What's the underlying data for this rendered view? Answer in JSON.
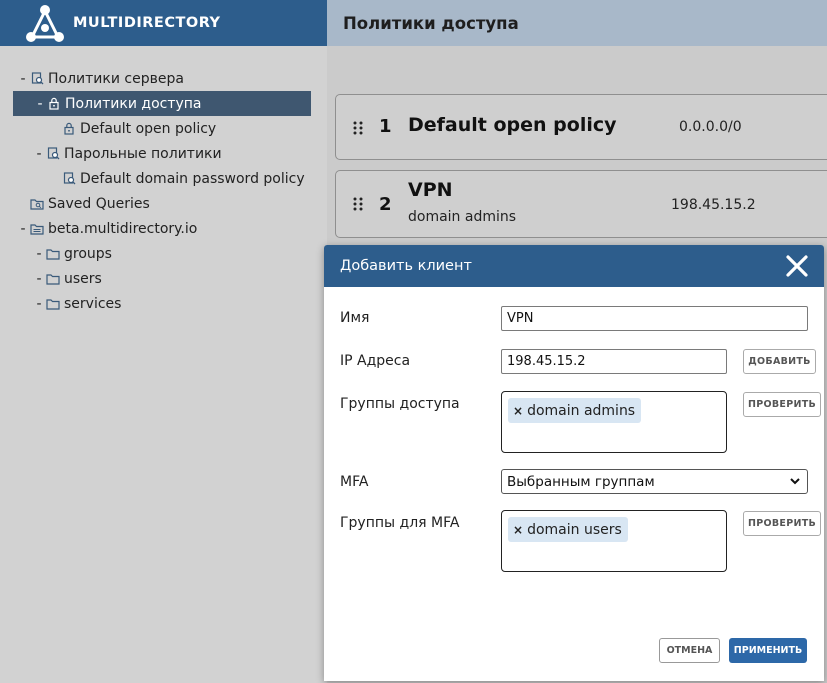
{
  "app": {
    "logo_text": "MULTIDIRECTORY"
  },
  "header": {
    "title": "Политики доступа"
  },
  "tree": [
    {
      "label": "Политики сервера",
      "icon": "search-policy-icon",
      "dash": "-"
    },
    {
      "label": "Политики доступа",
      "icon": "lock-icon",
      "dash": "-",
      "selected": true
    },
    {
      "label": "Default open policy",
      "icon": "lock-icon",
      "dash": ""
    },
    {
      "label": "Парольные политики",
      "icon": "search-policy-icon",
      "dash": "-"
    },
    {
      "label": "Default domain password policy",
      "icon": "search-policy-icon",
      "dash": ""
    },
    {
      "label": "Saved Queries",
      "icon": "saved-query-folder-icon",
      "dash": ""
    },
    {
      "label": "beta.multidirectory.io",
      "icon": "domain-folder-icon",
      "dash": "-"
    },
    {
      "label": "groups",
      "icon": "folder-icon",
      "dash": "-"
    },
    {
      "label": "users",
      "icon": "folder-icon",
      "dash": "-"
    },
    {
      "label": "services",
      "icon": "folder-icon",
      "dash": "-"
    }
  ],
  "policies": [
    {
      "number": "1",
      "name": "Default open policy",
      "subtitle": "",
      "ip": "0.0.0.0/0"
    },
    {
      "number": "2",
      "name": "VPN",
      "subtitle": "domain admins",
      "ip": "198.45.15.2"
    }
  ],
  "modal": {
    "title": "Добавить клиент",
    "name_label": "Имя",
    "name_value": "VPN",
    "ip_label": "IP Адреса",
    "ip_value": "198.45.15.2",
    "add_button": "ДОБАВИТЬ",
    "groups_label": "Группы доступа",
    "groups_tags": [
      "domain admins"
    ],
    "check_button": "ПРОВЕРИТЬ",
    "mfa_label": "MFA",
    "mfa_value": "Выбранным группам",
    "mfa_groups_label": "Группы для MFA",
    "mfa_groups_tags": [
      "domain users"
    ],
    "check_button_2": "ПРОВЕРИТЬ",
    "cancel_button": "ОТМЕНА",
    "apply_button": "ПРИМЕНИТЬ"
  },
  "colors": {
    "brand_blue": "#2d5d8c",
    "header_bg": "#a8b8c9",
    "selected_row": "#3f5770",
    "tag_bg": "#d8e6f3",
    "apply_button": "#2d68a8"
  }
}
